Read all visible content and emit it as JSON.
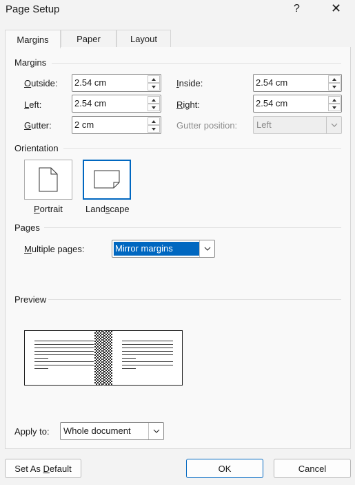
{
  "window": {
    "title": "Page Setup",
    "help_glyph": "?",
    "close_glyph": "✕"
  },
  "tabs": [
    {
      "label": "Margins"
    },
    {
      "label": "Paper"
    },
    {
      "label": "Layout"
    }
  ],
  "margins": {
    "section": "Margins",
    "outside": {
      "label_u": "O",
      "label_rest": "utside:",
      "value": "2.54 cm"
    },
    "left": {
      "label_u": "L",
      "label_rest": "eft:",
      "value": "2.54 cm"
    },
    "gutter": {
      "label_u": "G",
      "label_rest": "utter:",
      "value": "2 cm"
    },
    "inside": {
      "label_u": "I",
      "label_rest": "nside:",
      "value": "2.54 cm"
    },
    "right": {
      "label_u": "R",
      "label_rest": "ight:",
      "value": "2.54 cm"
    },
    "gutter_position": {
      "label": "Gutter position:",
      "value": "Left"
    }
  },
  "orientation": {
    "section": "Orientation",
    "portrait": {
      "label_u": "P",
      "label_rest": "ortrait"
    },
    "landscape": {
      "label_pre": "Land",
      "label_u": "s",
      "label_rest": "cape"
    },
    "selected": "landscape"
  },
  "pages": {
    "section": "Pages",
    "multiple_label_u": "M",
    "multiple_label_rest": "ultiple pages:",
    "multiple_value": "Mirror margins"
  },
  "preview": {
    "section": "Preview"
  },
  "apply": {
    "label": "Apply to:",
    "value": "Whole document"
  },
  "buttons": {
    "set_default_pre": "Set As ",
    "set_default_u": "D",
    "set_default_rest": "efault",
    "ok": "OK",
    "cancel": "Cancel"
  },
  "colors": {
    "accent": "#0067c0",
    "background": "#f3f3f3",
    "panel": "#f9f9f9"
  }
}
